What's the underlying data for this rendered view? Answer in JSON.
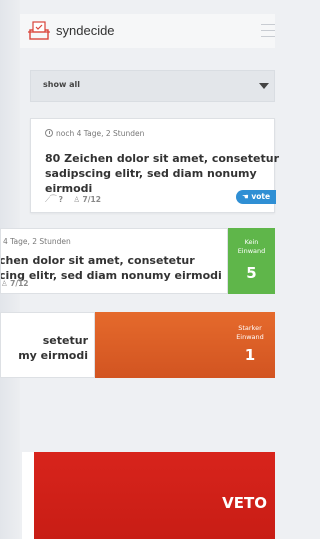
{
  "header": {
    "app_name": "syndecide",
    "logo_icon": "ballot-box-icon",
    "menu_icon": "hamburger-icon"
  },
  "filter": {
    "selected": "show all"
  },
  "cards": [
    {
      "time": "noch 4 Tage, 2 Stunden",
      "title_line1": "80 Zeichen dolor sit amet, consetetur",
      "title_line2": "sadipscing elitr, sed diam nonumy eirmodi",
      "info": "?",
      "participants": "7/12",
      "action": "vote"
    },
    {
      "time": "4 Tage, 2 Stunden",
      "title_line1": "chen dolor sit amet, consetetur",
      "title_line2": "cing elitr, sed diam nonumy eirmodi",
      "participants": "7/12",
      "status_label_line1": "Kein",
      "status_label_line2": "Einwand",
      "status_count": "5",
      "status_color": "#5fb64a"
    },
    {
      "title_line1": "setetur",
      "title_line2": "my eirmodi",
      "status_label_line1": "Starker",
      "status_label_line2": "Einwand",
      "status_count": "1",
      "status_color": "#e0612a"
    },
    {
      "status_label": "VETO",
      "status_color": "#d2211a"
    }
  ]
}
